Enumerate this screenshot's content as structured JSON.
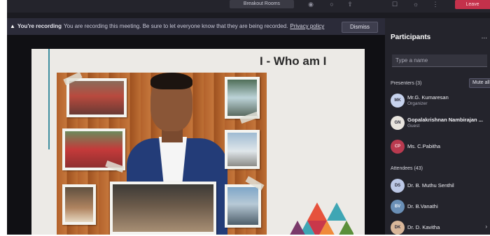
{
  "toolbar": {
    "meeting_info": "Breakout Rooms",
    "leave_label": "Leave",
    "icons": [
      "camera-icon",
      "mic-icon",
      "share-icon",
      "more-icon",
      "chat-icon",
      "participants-icon"
    ]
  },
  "banner": {
    "title": "You're recording",
    "message": "You are recording this meeting. Be sure to let everyone know that they are being recorded.",
    "link": "Privacy policy",
    "dismiss_label": "Dismiss"
  },
  "slide": {
    "title": "I - Who am I"
  },
  "participants": {
    "title": "Participants",
    "more_label": "...",
    "search_placeholder": "Type a name",
    "presenters_header": "Presenters (3)",
    "mute_all_label": "Mute all",
    "presenters": [
      {
        "initials": "MK",
        "name": "Mr.G. Kumaresan",
        "role": "Organizer",
        "color": "#c7d3ee"
      },
      {
        "initials": "GN",
        "name": "Gopalakrishnan Nambirajan ...",
        "role": "Guest",
        "color": "#e8e4de"
      },
      {
        "initials": "CP",
        "name": "Ms. C.Pabitha",
        "role": "",
        "color": "#b93a4f"
      }
    ],
    "attendees_header": "Attendees (43)",
    "attendees": [
      {
        "initials": "DS",
        "name": "Dr. B. Muthu Senthil",
        "color": "#bcc8e6"
      },
      {
        "initials": "BV",
        "name": "Dr. B.Vanathi",
        "color": "#6a8fb6"
      },
      {
        "initials": "DK",
        "name": "Dr. D. Kavitha",
        "color": "#d9b79a"
      }
    ]
  }
}
